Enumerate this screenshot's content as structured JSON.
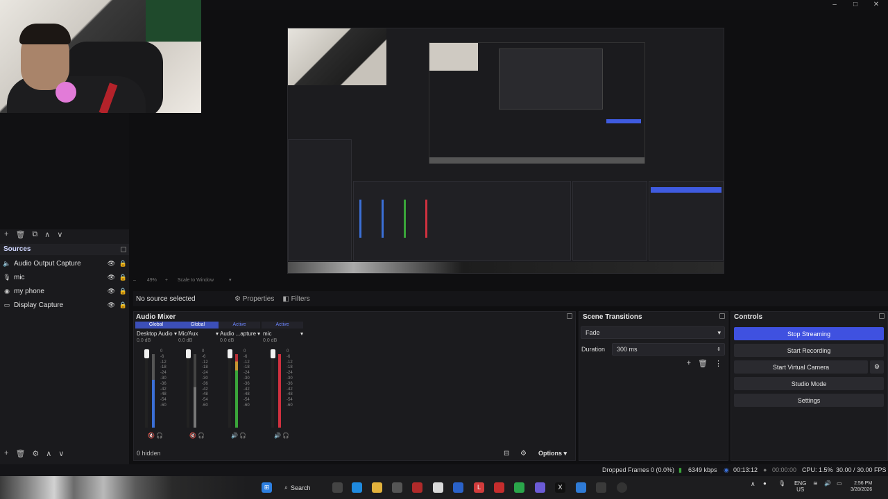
{
  "window": {
    "minimize": "–",
    "maximize": "□",
    "close": "✕"
  },
  "scene_toolbar": {
    "add": "+",
    "remove": "🗑",
    "filters": "⧉",
    "up": "∧",
    "down": "∨"
  },
  "sources": {
    "title": "Sources",
    "items": [
      {
        "icon": "speaker-icon",
        "label": "Audio Output Capture"
      },
      {
        "icon": "mic-icon",
        "label": "mic"
      },
      {
        "icon": "capture-device-icon",
        "label": "my phone"
      },
      {
        "icon": "display-icon",
        "label": "Display Capture"
      }
    ],
    "toolbar": {
      "add": "+",
      "remove": "🗑",
      "settings": "⚙",
      "up": "∧",
      "down": "∨"
    }
  },
  "scale_bar": {
    "zoom": "49%",
    "mode": "Scale to Window"
  },
  "context_bar": {
    "no_source": "No source selected",
    "properties": "Properties",
    "filters": "Filters"
  },
  "audio_mixer": {
    "title": "Audio Mixer",
    "channels": [
      {
        "tag": "Global",
        "name": "Desktop Audio",
        "db": "0.0 dB",
        "level": 0.65
      },
      {
        "tag": "Global",
        "name": "Mic/Aux",
        "db": "0.0 dB",
        "level": 0.55
      },
      {
        "tag": "Active",
        "name": "Audio ...apture",
        "db": "0.0 dB",
        "level": 0.8
      },
      {
        "tag": "Active",
        "name": "mic",
        "db": "0.0 dB",
        "level": 0.9
      }
    ],
    "scale": [
      "0",
      "-6",
      "-12",
      "-18",
      "-24",
      "-30",
      "-36",
      "-42",
      "-48",
      "-54",
      "-60"
    ],
    "hidden": "0 hidden",
    "options": "Options"
  },
  "scene_transitions": {
    "title": "Scene Transitions",
    "transition": "Fade",
    "duration_label": "Duration",
    "duration": "300 ms"
  },
  "controls": {
    "title": "Controls",
    "stop_streaming": "Stop Streaming",
    "start_recording": "Start Recording",
    "start_virtual_camera": "Start Virtual Camera",
    "studio_mode": "Studio Mode",
    "settings": "Settings"
  },
  "status": {
    "dropped": "Dropped Frames 0 (0.0%)",
    "kbps": "6349 kbps",
    "stream_time": "00:13:12",
    "rec_time": "00:00:00",
    "cpu": "CPU: 1.5%",
    "fps": "30.00 / 30.00 FPS"
  },
  "taskbar": {
    "search": "Search",
    "lang": "ENG",
    "region": "US",
    "time": "2:56 PM",
    "date": "3/28/2026"
  },
  "colors": {
    "accent": "#3f51e0",
    "active_label": "#6d86ff",
    "meter_green": "#3aa53a",
    "meter_red": "#d0313f",
    "meter_blue": "#3b6fd6"
  }
}
